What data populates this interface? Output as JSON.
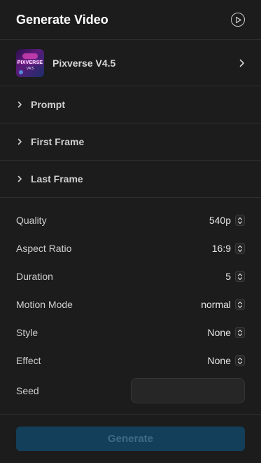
{
  "header": {
    "title": "Generate Video",
    "icon": "play-circle-icon"
  },
  "model": {
    "name": "Pixverse V4.5",
    "thumb_title": "PIXVERSE",
    "thumb_version": "V4.5"
  },
  "sections": [
    {
      "label": "Prompt"
    },
    {
      "label": "First Frame"
    },
    {
      "label": "Last Frame"
    }
  ],
  "settings": [
    {
      "label": "Quality",
      "value": "540p"
    },
    {
      "label": "Aspect Ratio",
      "value": "16:9"
    },
    {
      "label": "Duration",
      "value": "5"
    },
    {
      "label": "Motion Mode",
      "value": "normal"
    },
    {
      "label": "Style",
      "value": "None"
    },
    {
      "label": "Effect",
      "value": "None"
    }
  ],
  "seed": {
    "label": "Seed",
    "value": ""
  },
  "footer": {
    "generate_label": "Generate"
  }
}
